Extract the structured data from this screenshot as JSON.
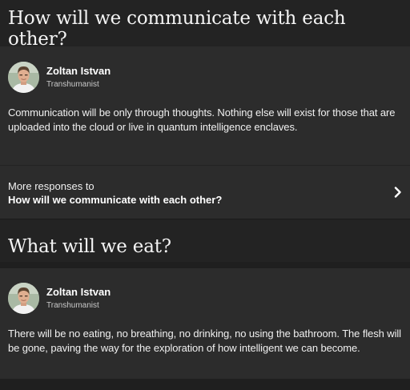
{
  "questions": [
    {
      "title": "How will we communicate with each other?",
      "answer": {
        "author_name": "Zoltan Istvan",
        "author_title": "Transhumanist",
        "text": "Communication will be only through thoughts. Nothing else will exist for those that are uploaded into the cloud or live in quantum intelligence enclaves."
      },
      "more": {
        "label": "More responses to",
        "question": "How will we communicate with each other?",
        "icon": "chevron-right-icon"
      }
    },
    {
      "title": "What will we eat?",
      "answer": {
        "author_name": "Zoltan Istvan",
        "author_title": "Transhumanist",
        "text": "There will be no eating, no breathing, no drinking, no using the bathroom. The flesh will be gone, paving the way for the exploration of how intelligent we can become."
      }
    }
  ],
  "colors": {
    "page_background": "#1f1f1f",
    "header_background": "#232323",
    "card_background": "#2c2c2c",
    "text_primary": "#ffffff",
    "text_secondary": "#c9c9c9"
  }
}
